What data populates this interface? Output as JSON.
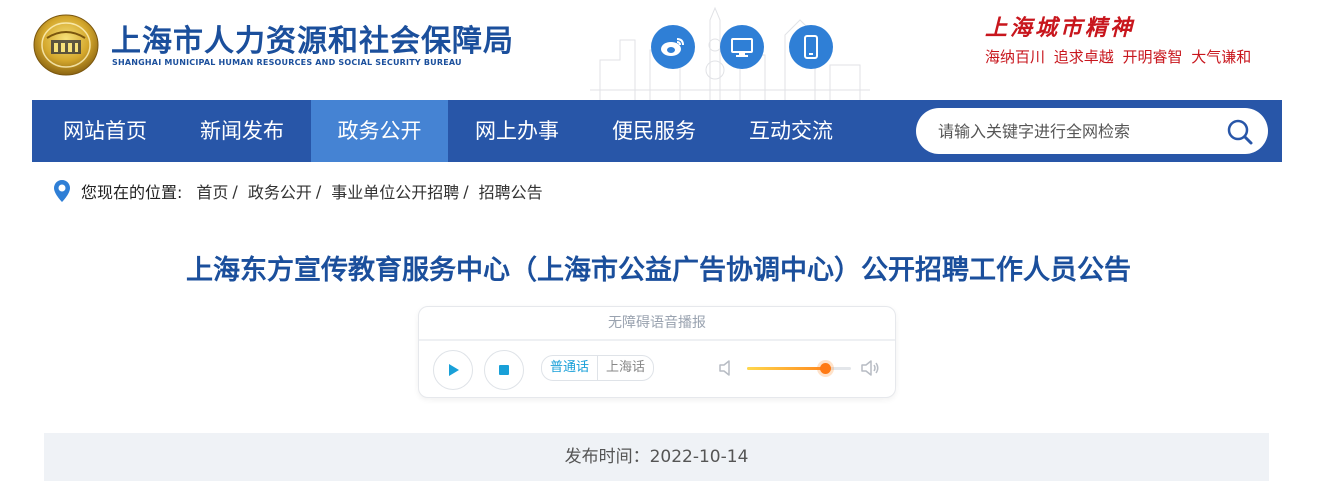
{
  "header": {
    "title_cn": "上海市人力资源和社会保障局",
    "title_en": "SHANGHAI MUNICIPAL HUMAN RESOURCES AND SOCIAL SECURITY BUREAU",
    "icons": [
      "weibo-icon",
      "desktop-icon",
      "mobile-icon"
    ],
    "spirit_title": "上海城市精神",
    "spirit_motto": "海纳百川 追求卓越 开明睿智 大气谦和"
  },
  "nav": {
    "items": [
      {
        "label": "网站首页"
      },
      {
        "label": "新闻发布"
      },
      {
        "label": "政务公开"
      },
      {
        "label": "网上办事"
      },
      {
        "label": "便民服务"
      },
      {
        "label": "互动交流"
      }
    ],
    "active_index": 2,
    "search_placeholder": "请输入关键字进行全网检索"
  },
  "breadcrumb": {
    "label": "您现在的位置:",
    "items": [
      "首页",
      "政务公开",
      "事业单位公开招聘",
      "招聘公告"
    ]
  },
  "article": {
    "title": "上海东方宣传教育服务中心（上海市公益广告协调中心）公开招聘工作人员公告",
    "publish_time": "发布时间：2022-10-14"
  },
  "player": {
    "header": "无障碍语音播报",
    "lang_mandarin": "普通话",
    "lang_shanghai": "上海话",
    "volume": 0.75
  },
  "colors": {
    "brand_blue": "#1b4f9c",
    "nav_bg": "#2856a8",
    "nav_active": "#4583d3",
    "spirit_red": "#c8161d",
    "accent_cyan": "#19a0d8",
    "volume_orange": "#ff7a14"
  }
}
